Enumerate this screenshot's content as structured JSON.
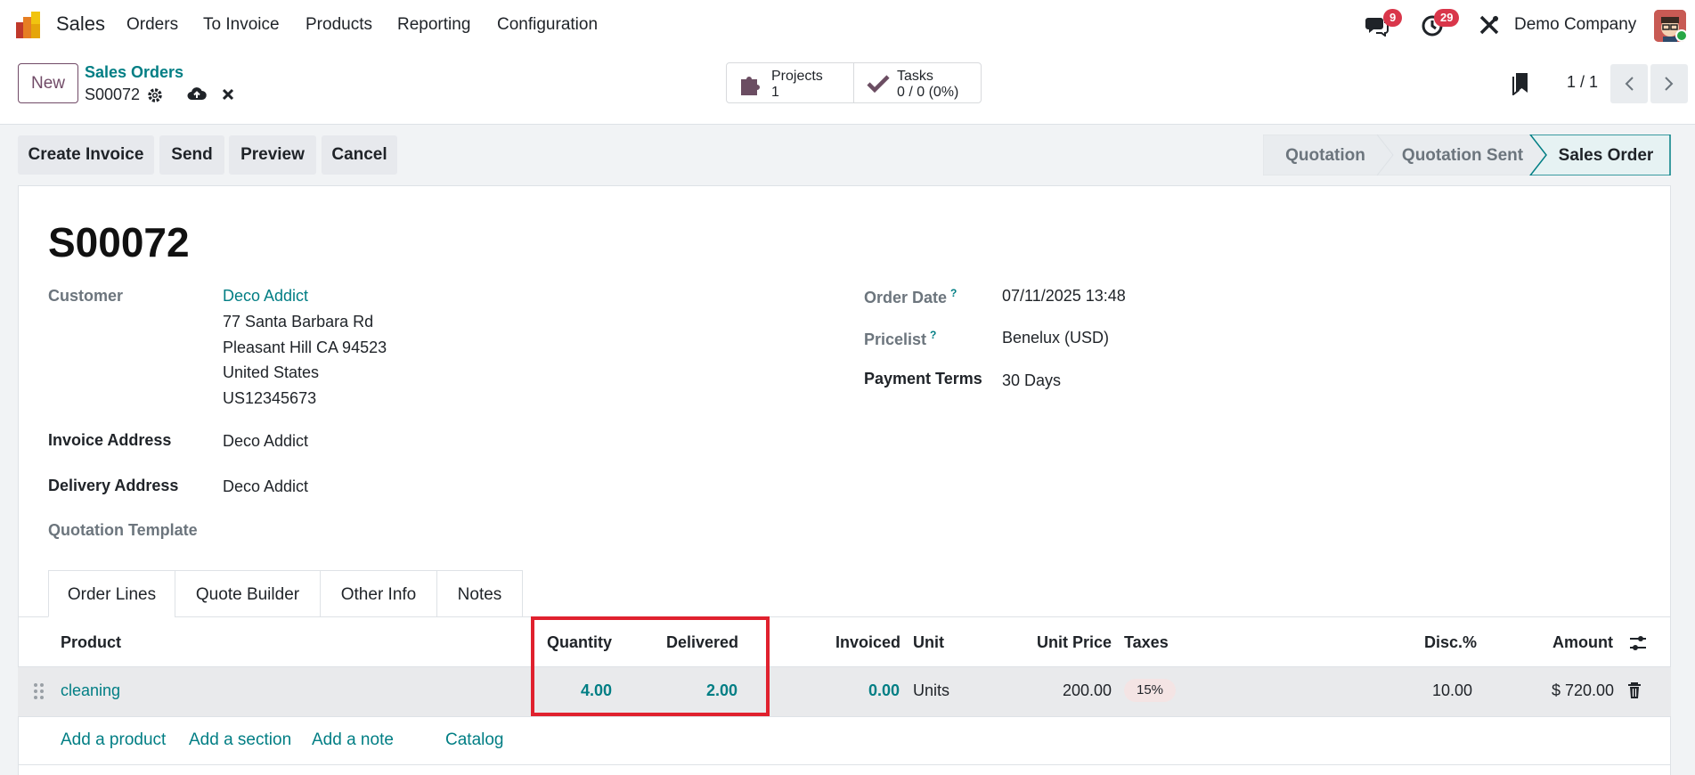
{
  "nav": {
    "app_name": "Sales",
    "menu": [
      "Orders",
      "To Invoice",
      "Products",
      "Reporting",
      "Configuration"
    ],
    "messages_count": "9",
    "activities_count": "29",
    "company": "Demo Company"
  },
  "control": {
    "new_label": "New",
    "breadcrumb_parent": "Sales Orders",
    "breadcrumb_current": "S00072",
    "projects_label": "Projects",
    "projects_value": "1",
    "tasks_label": "Tasks",
    "tasks_value": "0 / 0 (0%)",
    "pager": "1 / 1"
  },
  "actions": {
    "create_invoice": "Create Invoice",
    "send": "Send",
    "preview": "Preview",
    "cancel": "Cancel"
  },
  "stages": [
    "Quotation",
    "Quotation Sent",
    "Sales Order"
  ],
  "active_stage": "Sales Order",
  "order": {
    "name": "S00072",
    "customer_label": "Customer",
    "customer_name": "Deco Addict",
    "customer_address": [
      "77 Santa Barbara Rd",
      "Pleasant Hill CA 94523",
      "United States",
      "US12345673"
    ],
    "invoice_address_label": "Invoice Address",
    "invoice_address": "Deco Addict",
    "delivery_address_label": "Delivery Address",
    "delivery_address": "Deco Addict",
    "quotation_template_label": "Quotation Template",
    "order_date_label": "Order Date",
    "order_date": "07/11/2025 13:48",
    "pricelist_label": "Pricelist",
    "pricelist": "Benelux (USD)",
    "payment_terms_label": "Payment Terms",
    "payment_terms": "30 Days",
    "help_mark": "?"
  },
  "tabs": [
    "Order Lines",
    "Quote Builder",
    "Other Info",
    "Notes"
  ],
  "table": {
    "headers": {
      "product": "Product",
      "quantity": "Quantity",
      "delivered": "Delivered",
      "invoiced": "Invoiced",
      "unit": "Unit",
      "unit_price": "Unit Price",
      "taxes": "Taxes",
      "discount": "Disc.%",
      "amount": "Amount"
    },
    "rows": [
      {
        "product": "cleaning",
        "quantity": "4.00",
        "delivered": "2.00",
        "invoiced": "0.00",
        "unit": "Units",
        "unit_price": "200.00",
        "taxes": "15%",
        "discount": "10.00",
        "amount": "$ 720.00"
      }
    ],
    "add_links": [
      "Add a product",
      "Add a section",
      "Add a note",
      "Catalog"
    ]
  },
  "colors": {
    "brand": "#714b67",
    "link": "#017e84",
    "highlight": "#e0212e",
    "badge": "#d9364a"
  }
}
